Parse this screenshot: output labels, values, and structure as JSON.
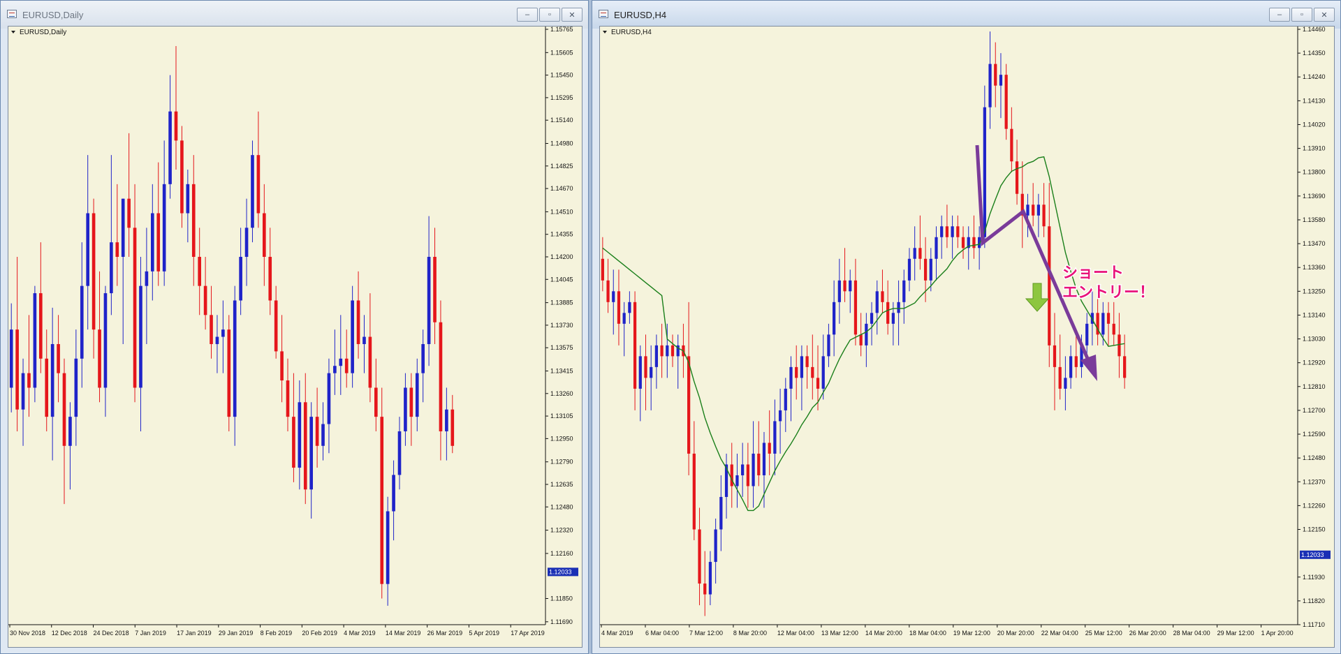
{
  "windows": {
    "left": {
      "title": "EURUSD,Daily",
      "chart_label": "EURUSD,Daily"
    },
    "right": {
      "title": "EURUSD,H4",
      "chart_label": "EURUSD,H4"
    }
  },
  "controls": {
    "minimize": "‒",
    "maximize": "▫",
    "close": "✕"
  },
  "colors": {
    "background": "#f5f3dc",
    "bull": "#1f23c9",
    "bear": "#e5161b",
    "ma": "#1a7f1a",
    "arrow": "#7a3b9a",
    "annotation": "#e8127a",
    "down_arrow": "#8dc63f",
    "price_box": "#1a2fb5"
  },
  "annotation": {
    "line1": "ショート",
    "line2": "エントリー！"
  },
  "chart_data": [
    {
      "type": "candlestick",
      "symbol": "EURUSD",
      "timeframe": "Daily",
      "ylim": [
        1.1167,
        1.15765
      ],
      "y_ticks": [
        "1.15765",
        "1.15605",
        "1.15450",
        "1.15295",
        "1.15140",
        "1.14980",
        "1.14825",
        "1.14670",
        "1.14510",
        "1.14355",
        "1.14200",
        "1.14045",
        "1.13885",
        "1.13730",
        "1.13575",
        "1.13415",
        "1.13260",
        "1.13105",
        "1.12950",
        "1.12790",
        "1.12635",
        "1.12480",
        "1.12320",
        "1.12160",
        "1.12033",
        "1.11850",
        "1.11690"
      ],
      "x_labels": [
        "30 Nov 2018",
        "12 Dec 2018",
        "24 Dec 2018",
        "7 Jan 2019",
        "17 Jan 2019",
        "29 Jan 2019",
        "8 Feb 2019",
        "20 Feb 2019",
        "4 Mar 2019",
        "14 Mar 2019",
        "26 Mar 2019",
        "5 Apr 2019",
        "17 Apr 2019"
      ],
      "current_price": "1.12033",
      "candles": [
        [
          1.133,
          1.1388,
          1.1313,
          1.137
        ],
        [
          1.137,
          1.142,
          1.13,
          1.1315
        ],
        [
          1.1315,
          1.135,
          1.129,
          1.134
        ],
        [
          1.134,
          1.138,
          1.131,
          1.133
        ],
        [
          1.133,
          1.14,
          1.132,
          1.1395
        ],
        [
          1.1395,
          1.143,
          1.134,
          1.135
        ],
        [
          1.135,
          1.137,
          1.13,
          1.131
        ],
        [
          1.131,
          1.1385,
          1.128,
          1.136
        ],
        [
          1.136,
          1.138,
          1.132,
          1.134
        ],
        [
          1.134,
          1.135,
          1.125,
          1.129
        ],
        [
          1.129,
          1.132,
          1.126,
          1.131
        ],
        [
          1.131,
          1.137,
          1.129,
          1.135
        ],
        [
          1.135,
          1.143,
          1.133,
          1.14
        ],
        [
          1.14,
          1.149,
          1.137,
          1.145
        ],
        [
          1.145,
          1.146,
          1.135,
          1.137
        ],
        [
          1.137,
          1.141,
          1.132,
          1.133
        ],
        [
          1.133,
          1.14,
          1.131,
          1.1395
        ],
        [
          1.1395,
          1.149,
          1.138,
          1.143
        ],
        [
          1.143,
          1.147,
          1.14,
          1.142
        ],
        [
          1.142,
          1.146,
          1.136,
          1.146
        ],
        [
          1.146,
          1.1505,
          1.142,
          1.144
        ],
        [
          1.144,
          1.147,
          1.132,
          1.133
        ],
        [
          1.133,
          1.142,
          1.13,
          1.14
        ],
        [
          1.14,
          1.144,
          1.136,
          1.141
        ],
        [
          1.141,
          1.147,
          1.139,
          1.145
        ],
        [
          1.145,
          1.1485,
          1.14,
          1.141
        ],
        [
          1.141,
          1.15,
          1.14,
          1.147
        ],
        [
          1.147,
          1.1545,
          1.146,
          1.152
        ],
        [
          1.152,
          1.1565,
          1.148,
          1.15
        ],
        [
          1.15,
          1.151,
          1.144,
          1.145
        ],
        [
          1.145,
          1.148,
          1.143,
          1.147
        ],
        [
          1.147,
          1.149,
          1.14,
          1.142
        ],
        [
          1.142,
          1.144,
          1.138,
          1.14
        ],
        [
          1.14,
          1.142,
          1.137,
          1.138
        ],
        [
          1.138,
          1.14,
          1.135,
          1.136
        ],
        [
          1.136,
          1.138,
          1.134,
          1.1365
        ],
        [
          1.1365,
          1.139,
          1.134,
          1.137
        ],
        [
          1.137,
          1.138,
          1.13,
          1.131
        ],
        [
          1.131,
          1.14,
          1.129,
          1.139
        ],
        [
          1.139,
          1.144,
          1.138,
          1.142
        ],
        [
          1.142,
          1.146,
          1.14,
          1.144
        ],
        [
          1.144,
          1.15,
          1.143,
          1.149
        ],
        [
          1.149,
          1.152,
          1.144,
          1.145
        ],
        [
          1.145,
          1.147,
          1.14,
          1.142
        ],
        [
          1.142,
          1.144,
          1.138,
          1.139
        ],
        [
          1.139,
          1.14,
          1.135,
          1.1355
        ],
        [
          1.1355,
          1.138,
          1.132,
          1.1335
        ],
        [
          1.1335,
          1.135,
          1.13,
          1.131
        ],
        [
          1.131,
          1.134,
          1.1265,
          1.1275
        ],
        [
          1.1275,
          1.1335,
          1.126,
          1.132
        ],
        [
          1.132,
          1.134,
          1.125,
          1.126
        ],
        [
          1.126,
          1.132,
          1.124,
          1.131
        ],
        [
          1.131,
          1.133,
          1.1275,
          1.129
        ],
        [
          1.129,
          1.132,
          1.128,
          1.1305
        ],
        [
          1.1305,
          1.135,
          1.1285,
          1.134
        ],
        [
          1.134,
          1.137,
          1.1325,
          1.1345
        ],
        [
          1.1345,
          1.138,
          1.1325,
          1.135
        ],
        [
          1.135,
          1.137,
          1.133,
          1.134
        ],
        [
          1.134,
          1.14,
          1.133,
          1.139
        ],
        [
          1.139,
          1.141,
          1.135,
          1.136
        ],
        [
          1.136,
          1.138,
          1.134,
          1.1365
        ],
        [
          1.1365,
          1.1395,
          1.132,
          1.133
        ],
        [
          1.133,
          1.135,
          1.13,
          1.131
        ],
        [
          1.131,
          1.133,
          1.1185,
          1.1195
        ],
        [
          1.1195,
          1.1255,
          1.118,
          1.1245
        ],
        [
          1.1245,
          1.128,
          1.1225,
          1.127
        ],
        [
          1.127,
          1.131,
          1.126,
          1.13
        ],
        [
          1.13,
          1.134,
          1.129,
          1.133
        ],
        [
          1.133,
          1.134,
          1.129,
          1.131
        ],
        [
          1.131,
          1.135,
          1.13,
          1.134
        ],
        [
          1.134,
          1.137,
          1.132,
          1.136
        ],
        [
          1.136,
          1.1448,
          1.1345,
          1.142
        ],
        [
          1.142,
          1.144,
          1.136,
          1.1375
        ],
        [
          1.1375,
          1.139,
          1.128,
          1.13
        ],
        [
          1.13,
          1.133,
          1.128,
          1.1315
        ],
        [
          1.1315,
          1.1325,
          1.1285,
          1.129
        ]
      ]
    },
    {
      "type": "candlestick",
      "symbol": "EURUSD",
      "timeframe": "H4",
      "ylim": [
        1.1171,
        1.1446
      ],
      "y_ticks": [
        "1.14460",
        "1.14350",
        "1.14240",
        "1.14130",
        "1.14020",
        "1.13910",
        "1.13800",
        "1.13690",
        "1.13580",
        "1.13470",
        "1.13360",
        "1.13250",
        "1.13140",
        "1.13030",
        "1.12920",
        "1.12810",
        "1.12700",
        "1.12590",
        "1.12480",
        "1.12370",
        "1.12260",
        "1.12150",
        "1.12033",
        "1.11930",
        "1.11820",
        "1.11710"
      ],
      "x_labels": [
        "4 Mar 2019",
        "6 Mar 04:00",
        "7 Mar 12:00",
        "8 Mar 20:00",
        "12 Mar 04:00",
        "13 Mar 12:00",
        "14 Mar 20:00",
        "18 Mar 04:00",
        "19 Mar 12:00",
        "20 Mar 20:00",
        "22 Mar 04:00",
        "25 Mar 12:00",
        "26 Mar 20:00",
        "28 Mar 04:00",
        "29 Mar 12:00",
        "1 Apr 20:00"
      ],
      "current_price": "1.12033",
      "indicator": "moving average (green line)",
      "candles": [
        [
          1.134,
          1.135,
          1.1325,
          1.133
        ],
        [
          1.133,
          1.134,
          1.1315,
          1.132
        ],
        [
          1.132,
          1.1335,
          1.1305,
          1.1325
        ],
        [
          1.1325,
          1.1335,
          1.13,
          1.131
        ],
        [
          1.131,
          1.132,
          1.1295,
          1.1315
        ],
        [
          1.1315,
          1.1325,
          1.131,
          1.132
        ],
        [
          1.132,
          1.1325,
          1.127,
          1.128
        ],
        [
          1.128,
          1.13,
          1.1265,
          1.1295
        ],
        [
          1.1295,
          1.1305,
          1.127,
          1.1285
        ],
        [
          1.1285,
          1.13,
          1.127,
          1.129
        ],
        [
          1.129,
          1.1305,
          1.128,
          1.13
        ],
        [
          1.13,
          1.131,
          1.1285,
          1.1295
        ],
        [
          1.1295,
          1.131,
          1.1285,
          1.13
        ],
        [
          1.13,
          1.1305,
          1.129,
          1.1295
        ],
        [
          1.1295,
          1.1305,
          1.128,
          1.13
        ],
        [
          1.13,
          1.131,
          1.1285,
          1.1295
        ],
        [
          1.1295,
          1.132,
          1.124,
          1.125
        ],
        [
          1.125,
          1.1265,
          1.121,
          1.1215
        ],
        [
          1.1215,
          1.1225,
          1.118,
          1.119
        ],
        [
          1.119,
          1.1205,
          1.1175,
          1.1185
        ],
        [
          1.1185,
          1.1205,
          1.118,
          1.12
        ],
        [
          1.12,
          1.122,
          1.119,
          1.1215
        ],
        [
          1.1215,
          1.124,
          1.1205,
          1.123
        ],
        [
          1.123,
          1.125,
          1.122,
          1.1245
        ],
        [
          1.1245,
          1.1255,
          1.1225,
          1.1235
        ],
        [
          1.1235,
          1.125,
          1.1225,
          1.124
        ],
        [
          1.124,
          1.1255,
          1.123,
          1.1245
        ],
        [
          1.1245,
          1.1255,
          1.1225,
          1.1235
        ],
        [
          1.1235,
          1.1265,
          1.1225,
          1.125
        ],
        [
          1.125,
          1.1265,
          1.1235,
          1.124
        ],
        [
          1.124,
          1.126,
          1.1225,
          1.1255
        ],
        [
          1.1255,
          1.127,
          1.124,
          1.125
        ],
        [
          1.125,
          1.1275,
          1.124,
          1.1265
        ],
        [
          1.1265,
          1.128,
          1.125,
          1.127
        ],
        [
          1.127,
          1.1285,
          1.126,
          1.128
        ],
        [
          1.128,
          1.1295,
          1.1265,
          1.129
        ],
        [
          1.129,
          1.13,
          1.1275,
          1.1285
        ],
        [
          1.1285,
          1.13,
          1.127,
          1.1295
        ],
        [
          1.1295,
          1.13,
          1.128,
          1.129
        ],
        [
          1.129,
          1.1305,
          1.1275,
          1.1285
        ],
        [
          1.1285,
          1.13,
          1.127,
          1.128
        ],
        [
          1.128,
          1.1305,
          1.1275,
          1.1295
        ],
        [
          1.1295,
          1.131,
          1.129,
          1.1305
        ],
        [
          1.1305,
          1.133,
          1.1295,
          1.132
        ],
        [
          1.132,
          1.134,
          1.131,
          1.133
        ],
        [
          1.133,
          1.1345,
          1.132,
          1.1325
        ],
        [
          1.1325,
          1.1335,
          1.1315,
          1.133
        ],
        [
          1.133,
          1.134,
          1.13,
          1.1305
        ],
        [
          1.1305,
          1.1315,
          1.1295,
          1.13
        ],
        [
          1.13,
          1.1315,
          1.129,
          1.131
        ],
        [
          1.131,
          1.132,
          1.13,
          1.1315
        ],
        [
          1.1315,
          1.133,
          1.1305,
          1.1325
        ],
        [
          1.1325,
          1.1335,
          1.1315,
          1.132
        ],
        [
          1.132,
          1.133,
          1.1305,
          1.131
        ],
        [
          1.131,
          1.132,
          1.13,
          1.1315
        ],
        [
          1.1315,
          1.133,
          1.13,
          1.132
        ],
        [
          1.132,
          1.1335,
          1.131,
          1.133
        ],
        [
          1.133,
          1.1345,
          1.1325,
          1.134
        ],
        [
          1.134,
          1.1355,
          1.133,
          1.1345
        ],
        [
          1.1345,
          1.136,
          1.1335,
          1.134
        ],
        [
          1.134,
          1.135,
          1.132,
          1.133
        ],
        [
          1.133,
          1.1345,
          1.1325,
          1.134
        ],
        [
          1.134,
          1.1355,
          1.133,
          1.135
        ],
        [
          1.135,
          1.136,
          1.134,
          1.1355
        ],
        [
          1.1355,
          1.1365,
          1.1345,
          1.135
        ],
        [
          1.135,
          1.136,
          1.134,
          1.1355
        ],
        [
          1.1355,
          1.136,
          1.1345,
          1.135
        ],
        [
          1.135,
          1.1355,
          1.134,
          1.1345
        ],
        [
          1.1345,
          1.1355,
          1.1335,
          1.135
        ],
        [
          1.135,
          1.136,
          1.134,
          1.1345
        ],
        [
          1.1345,
          1.1355,
          1.1335,
          1.135
        ],
        [
          1.135,
          1.142,
          1.1345,
          1.141
        ],
        [
          1.141,
          1.1445,
          1.14,
          1.143
        ],
        [
          1.143,
          1.144,
          1.141,
          1.142
        ],
        [
          1.142,
          1.1435,
          1.1405,
          1.1425
        ],
        [
          1.1425,
          1.143,
          1.1395,
          1.14
        ],
        [
          1.14,
          1.141,
          1.138,
          1.1385
        ],
        [
          1.1385,
          1.1395,
          1.1365,
          1.137
        ],
        [
          1.137,
          1.1385,
          1.1345,
          1.136
        ],
        [
          1.136,
          1.137,
          1.135,
          1.1365
        ],
        [
          1.1365,
          1.1375,
          1.1355,
          1.136
        ],
        [
          1.136,
          1.137,
          1.135,
          1.1365
        ],
        [
          1.1365,
          1.1375,
          1.135,
          1.1355
        ],
        [
          1.1355,
          1.1375,
          1.129,
          1.13
        ],
        [
          1.13,
          1.1315,
          1.127,
          1.129
        ],
        [
          1.129,
          1.1305,
          1.1275,
          1.128
        ],
        [
          1.128,
          1.1295,
          1.127,
          1.1285
        ],
        [
          1.1285,
          1.13,
          1.128,
          1.1295
        ],
        [
          1.1295,
          1.1305,
          1.1285,
          1.129
        ],
        [
          1.129,
          1.1305,
          1.1285,
          1.13
        ],
        [
          1.13,
          1.1315,
          1.129,
          1.131
        ],
        [
          1.131,
          1.1325,
          1.13,
          1.1315
        ],
        [
          1.1315,
          1.1325,
          1.13,
          1.1305
        ],
        [
          1.1305,
          1.132,
          1.13,
          1.1315
        ],
        [
          1.1315,
          1.132,
          1.13,
          1.131
        ],
        [
          1.131,
          1.132,
          1.13,
          1.1305
        ],
        [
          1.1305,
          1.1315,
          1.1285,
          1.1295
        ],
        [
          1.1295,
          1.1305,
          1.128,
          1.1285
        ]
      ]
    }
  ]
}
